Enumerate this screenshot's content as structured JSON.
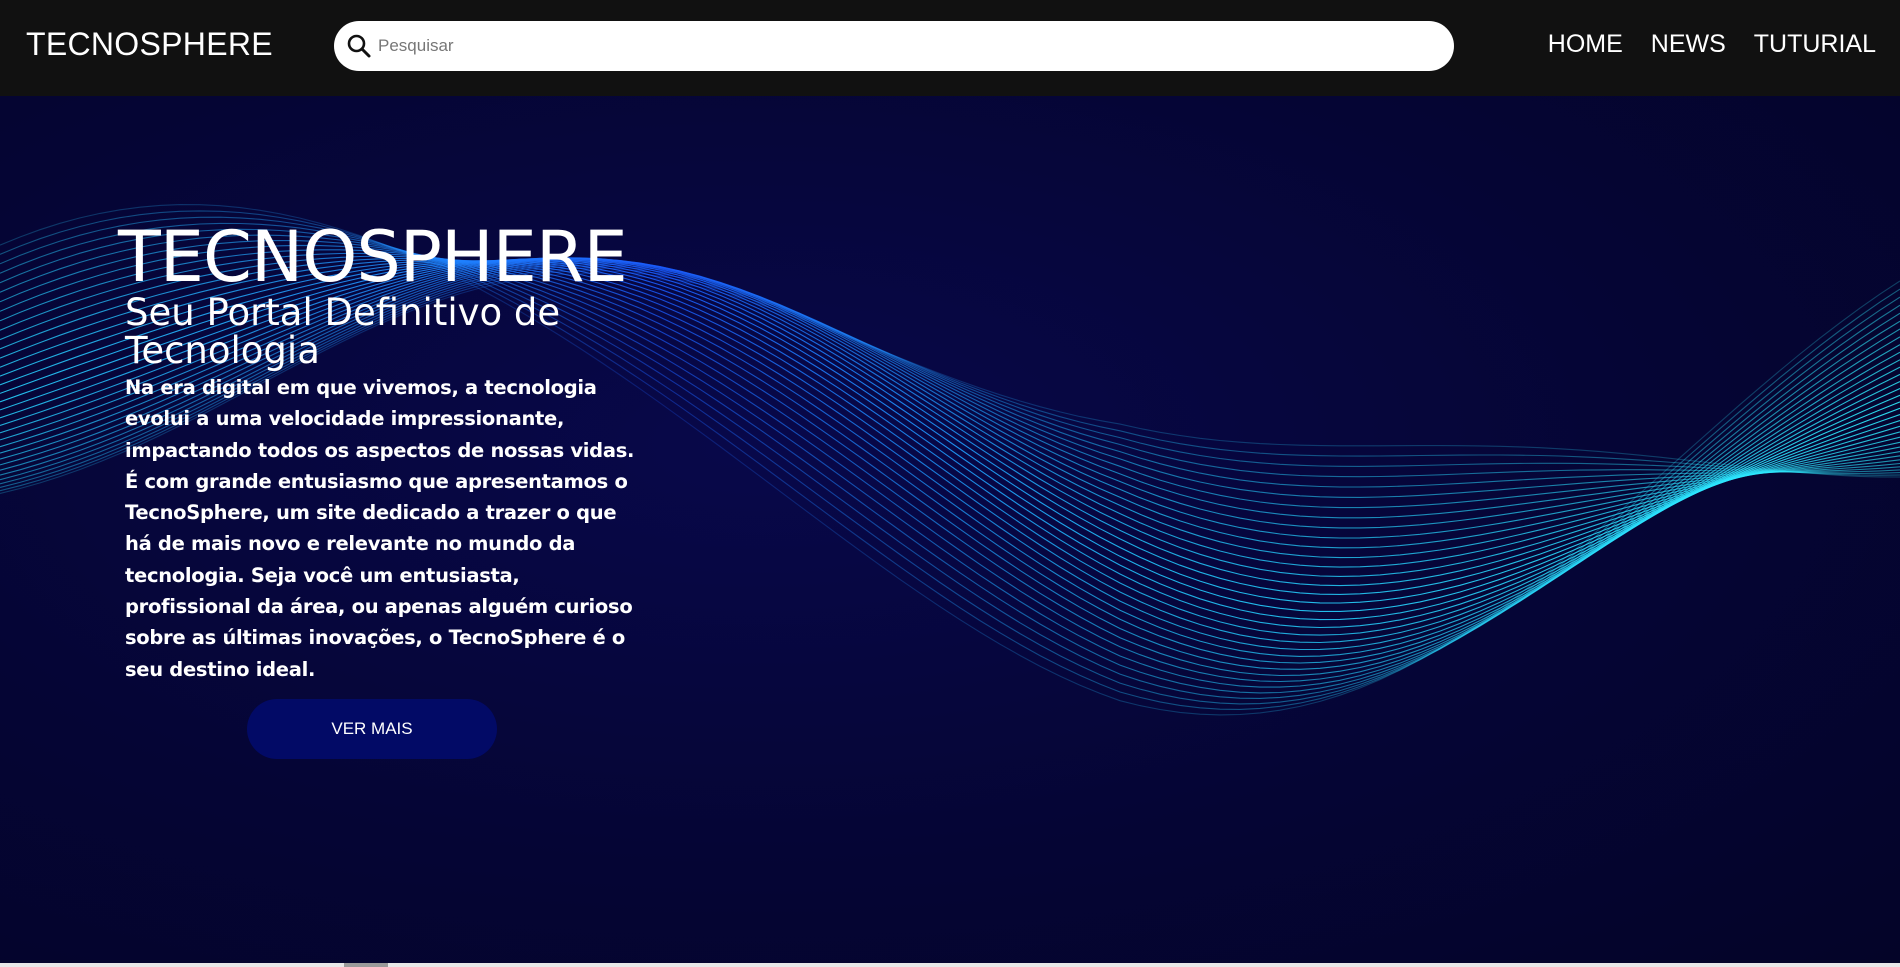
{
  "header": {
    "brand": "TECNOSPHERE",
    "search": {
      "placeholder": "Pesquisar"
    },
    "nav": [
      {
        "label": "HOME"
      },
      {
        "label": "NEWS"
      },
      {
        "label": "TUTURIAL"
      }
    ]
  },
  "hero": {
    "title": "TECNOSPHERE",
    "subtitle": "Seu Portal Definitivo de Tecnologia",
    "text": "Na era digital em que vivemos, a tecnologia evolui a uma velocidade impressionante, impactando todos os aspectos de nossas vidas. É com grande entusiasmo que apresentamos o TecnoSphere, um site dedicado a trazer o que há de mais novo e relevante no mundo da tecnologia. Seja você um entusiasta, profissional da área, ou apenas alguém curioso sobre as últimas inovações, o TecnoSphere é o seu destino ideal.",
    "button_label": "VER MAIS",
    "background_image": "wave-lines-graphic"
  },
  "colors": {
    "header_bg": "#111111",
    "hero_bg": "#050535",
    "button_bg": "#020a66",
    "wave_light": "#27e4ff",
    "wave_dark": "#1a2bff"
  }
}
